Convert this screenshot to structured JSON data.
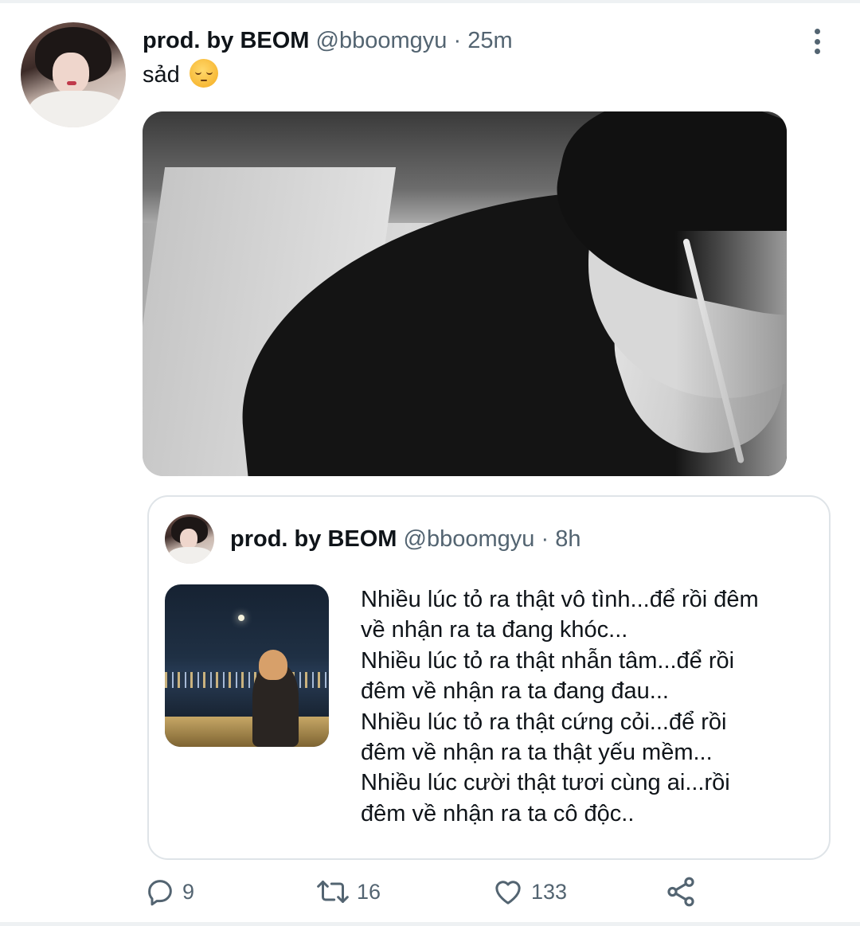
{
  "tweet": {
    "display_name": "prod. by BEOM",
    "handle": "@bboomgyu",
    "separator": "·",
    "time": "25m",
    "text": "sảd",
    "emoji": "pensive-face-emoji"
  },
  "quoted_tweet": {
    "display_name": "prod. by BEOM",
    "handle": "@bboomgyu",
    "separator": "·",
    "time": "8h",
    "lines": [
      "Nhiều lúc tỏ ra thật vô tình...để rồi đêm",
      "về nhận ra ta đang khóc...",
      "Nhiều lúc tỏ ra thật nhẫn tâm...để rồi",
      "đêm về nhận ra ta đang đau...",
      "Nhiều lúc tỏ ra thật cứng cỏi...để rồi",
      "đêm về nhận ra ta thật yếu mềm...",
      "Nhiều lúc cười thật tươi cùng ai...rồi",
      "đêm về nhận ra ta cô độc.."
    ]
  },
  "actions": {
    "reply_count": "9",
    "retweet_count": "16",
    "like_count": "133"
  },
  "icons": {
    "more": "more-vertical-icon",
    "reply": "reply-icon",
    "retweet": "retweet-icon",
    "like": "heart-icon",
    "share": "share-icon"
  },
  "colors": {
    "text": "#0f1419",
    "secondary": "#536471",
    "border": "#dfe4e8"
  }
}
